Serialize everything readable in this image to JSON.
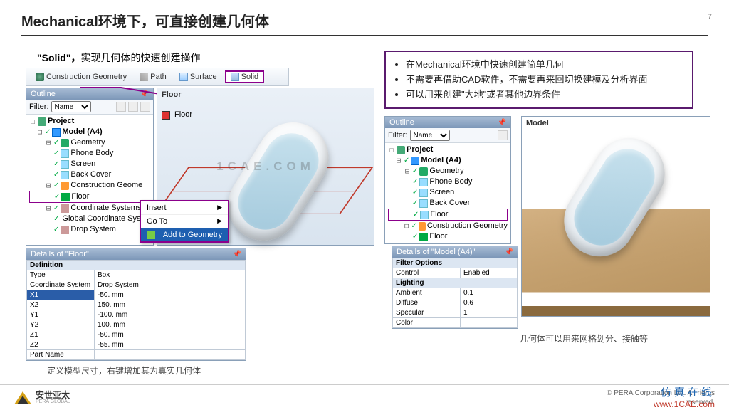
{
  "header": {
    "title": "Mechanical环境下，可直接创建几何体",
    "page_no": "7"
  },
  "left": {
    "solid_label_prefix": "\"Solid\"，",
    "solid_label_rest": "实现几何体的快速创建操作",
    "toolbar": {
      "construction": "Construction Geometry",
      "path": "Path",
      "surface": "Surface",
      "solid": "Solid"
    },
    "outline_title": "Outline",
    "filter_label": "Filter:",
    "filter_value": "Name",
    "tree": {
      "project": "Project",
      "model": "Model (A4)",
      "geometry": "Geometry",
      "phone": "Phone Body",
      "screen": "Screen",
      "back": "Back Cover",
      "construction": "Construction Geome",
      "floor": "Floor",
      "coord": "Coordinate Systems",
      "global": "Global Coordinate System",
      "drop": "Drop System"
    },
    "ctx": {
      "insert": "Insert",
      "goto": "Go To",
      "add": "Add to Geometry"
    },
    "details_title": "Details of \"Floor\"",
    "details_group": "Definition",
    "details": {
      "type_k": "Type",
      "type_v": "Box",
      "cs_k": "Coordinate System",
      "cs_v": "Drop System",
      "x1_k": "X1",
      "x1_v": "-50. mm",
      "x2_k": "X2",
      "x2_v": "150. mm",
      "y1_k": "Y1",
      "y1_v": "-100. mm",
      "y2_k": "Y2",
      "y2_v": "100. mm",
      "z1_k": "Z1",
      "z1_v": "-50. mm",
      "z2_k": "Z2",
      "z2_v": "-55. mm",
      "part_k": "Part Name",
      "part_v": ""
    },
    "viewport_title": "Floor",
    "legend": "Floor",
    "caption": "定义模型尺寸，右键增加其为真实几何体"
  },
  "right": {
    "bullets": {
      "b1": "在Mechanical环境中快速创建简单几何",
      "b2": "不需要再借助CAD软件，不需要再来回切换建模及分析界面",
      "b3": "可以用来创建\"大地\"或者其他边界条件"
    },
    "outline_title": "Outline",
    "filter_label": "Filter:",
    "filter_value": "Name",
    "tree": {
      "project": "Project",
      "model": "Model (A4)",
      "geometry": "Geometry",
      "phone": "Phone Body",
      "screen": "Screen",
      "back": "Back Cover",
      "floor_body": "Floor",
      "construction": "Construction Geometry",
      "floor": "Floor"
    },
    "details_title": "Details of \"Model (A4)\"",
    "groups": {
      "filter": "Filter Options",
      "control_k": "Control",
      "control_v": "Enabled",
      "lighting": "Lighting",
      "amb_k": "Ambient",
      "amb_v": "0.1",
      "dif_k": "Diffuse",
      "dif_v": "0.6",
      "spec_k": "Specular",
      "spec_v": "1",
      "col_k": "Color",
      "col_v": ""
    },
    "viewport_title": "Model",
    "caption": "几何体可以用来网格划分、接触等"
  },
  "footer": {
    "brand_cn": "安世亚太",
    "brand_en": "PERA GLOBAL",
    "copy1": "©  PERA Corporation Ltd. All rights",
    "copy2": "reserved.",
    "overlay1": "仿真在线",
    "overlay2": "www.1CAE.com"
  },
  "watermark": "1CAE.COM"
}
